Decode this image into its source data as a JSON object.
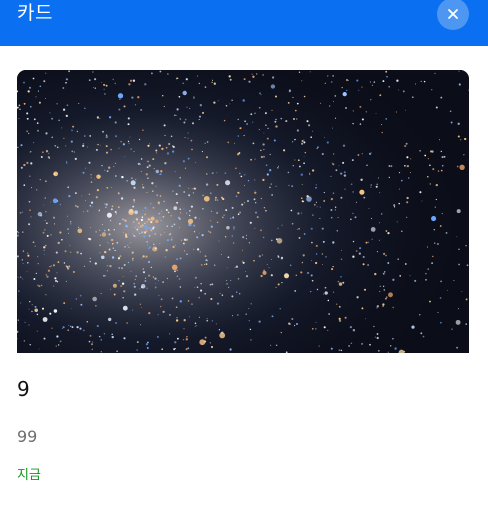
{
  "header": {
    "title": "카드",
    "background_color": "#0a6ff0",
    "close_icon": "close-icon"
  },
  "card": {
    "image_alt": "star cluster",
    "title": "9",
    "subtitle": "99",
    "time": "지금",
    "time_color": "#11961d"
  }
}
